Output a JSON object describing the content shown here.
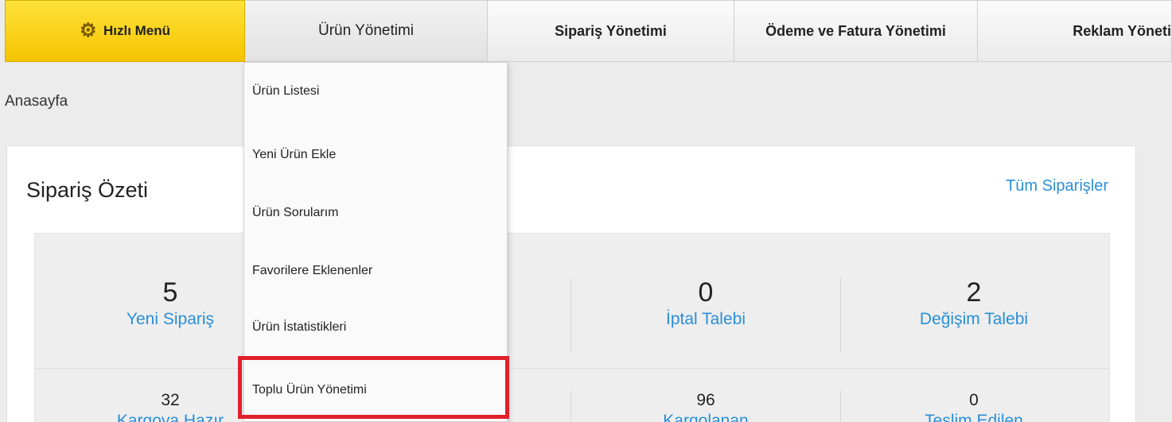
{
  "nav": {
    "quick_menu": "Hızlı Menü",
    "products": "Ürün Yönetimi",
    "orders": "Sipariş Yönetimi",
    "payment": "Ödeme ve Fatura Yönetimi",
    "ads": "Reklam Yöneti"
  },
  "breadcrumb": "Anasayfa",
  "order_summary": {
    "title": "Sipariş Özeti",
    "all_orders_link": "Tüm Siparişler",
    "stats": [
      {
        "value": "5",
        "label": "Yeni Sipariş"
      },
      {
        "value": "0",
        "label": "İptal Talebi"
      },
      {
        "value": "2",
        "label": "Değişim Talebi"
      },
      {
        "value": "32",
        "label": "Kargoya Hazır"
      },
      {
        "value": "96",
        "label": "Kargolanan"
      },
      {
        "value": "0",
        "label": "Teslim Edilen"
      }
    ]
  },
  "dropdown": {
    "items": [
      "Ürün Listesi",
      "Yeni Ürün Ekle",
      "Ürün Sorularım",
      "Favorilere Eklenenler",
      "Ürün İstatistikleri",
      "Toplu Ürün Yönetimi"
    ]
  },
  "colors": {
    "accent_yellow": "#f4c400",
    "link_blue": "#2a8fd8",
    "highlight_red": "#e0202a"
  },
  "icons": {
    "quick_menu": "gear-icon"
  }
}
